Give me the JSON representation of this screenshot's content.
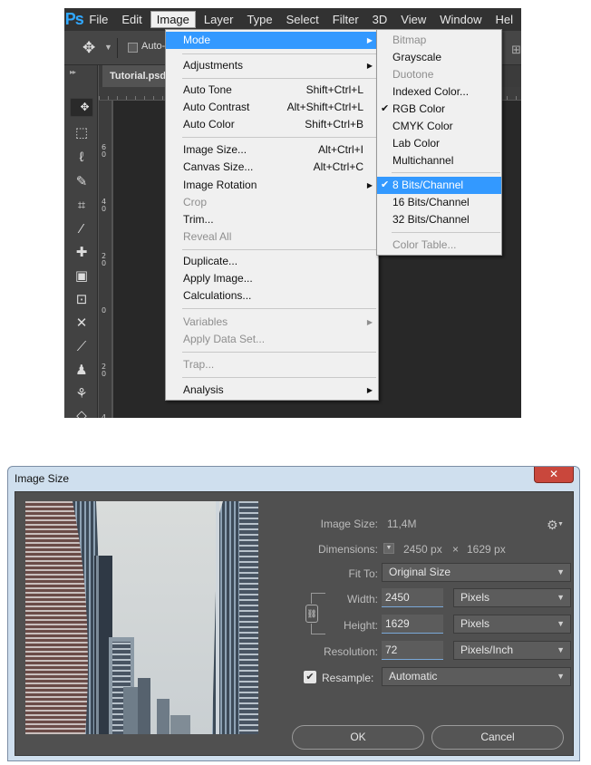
{
  "photoshop": {
    "logo": "Ps",
    "menubar": [
      "File",
      "Edit",
      "Image",
      "Layer",
      "Type",
      "Select",
      "Filter",
      "3D",
      "View",
      "Window",
      "Hel"
    ],
    "active_menu": "Image",
    "options_bar": {
      "auto_select_label": "Auto-S"
    },
    "document_tab": "Tutorial.psd",
    "ruler_numbers": [
      "6 0",
      "4 0",
      "2 0",
      "0",
      "2 0",
      "4"
    ],
    "image_menu": {
      "mode": "Mode",
      "adjustments": "Adjustments",
      "auto_tone": "Auto Tone",
      "auto_tone_sc": "Shift+Ctrl+L",
      "auto_contrast": "Auto Contrast",
      "auto_contrast_sc": "Alt+Shift+Ctrl+L",
      "auto_color": "Auto Color",
      "auto_color_sc": "Shift+Ctrl+B",
      "image_size": "Image Size...",
      "image_size_sc": "Alt+Ctrl+I",
      "canvas_size": "Canvas Size...",
      "canvas_size_sc": "Alt+Ctrl+C",
      "image_rotation": "Image Rotation",
      "crop": "Crop",
      "trim": "Trim...",
      "reveal_all": "Reveal All",
      "duplicate": "Duplicate...",
      "apply_image": "Apply Image...",
      "calculations": "Calculations...",
      "variables": "Variables",
      "apply_data_set": "Apply Data Set...",
      "trap": "Trap...",
      "analysis": "Analysis"
    },
    "mode_submenu": {
      "bitmap": "Bitmap",
      "grayscale": "Grayscale",
      "duotone": "Duotone",
      "indexed": "Indexed Color...",
      "rgb": "RGB Color",
      "cmyk": "CMYK Color",
      "lab": "Lab Color",
      "multichannel": "Multichannel",
      "bits8": "8 Bits/Channel",
      "bits16": "16 Bits/Channel",
      "bits32": "32 Bits/Channel",
      "color_table": "Color Table...",
      "checkmark": "✔"
    }
  },
  "image_size_dialog": {
    "title": "Image Size",
    "close_glyph": "✕",
    "image_size_label": "Image Size:",
    "image_size_value": "11,4M",
    "dimensions_label": "Dimensions:",
    "dimensions_width": "2450 px",
    "dimensions_times": "×",
    "dimensions_height": "1629 px",
    "fit_to_label": "Fit To:",
    "fit_to_value": "Original Size",
    "width_label": "Width:",
    "width_value": "2450",
    "width_unit": "Pixels",
    "height_label": "Height:",
    "height_value": "1629",
    "height_unit": "Pixels",
    "resolution_label": "Resolution:",
    "resolution_value": "72",
    "resolution_unit": "Pixels/Inch",
    "resample_label": "Resample:",
    "resample_value": "Automatic",
    "resample_checked": "✔",
    "ok_label": "OK",
    "cancel_label": "Cancel"
  },
  "colors": {
    "menu_highlight": "#3399ff",
    "ps_logo": "#31a8ff",
    "dialog_bg": "#505050"
  }
}
